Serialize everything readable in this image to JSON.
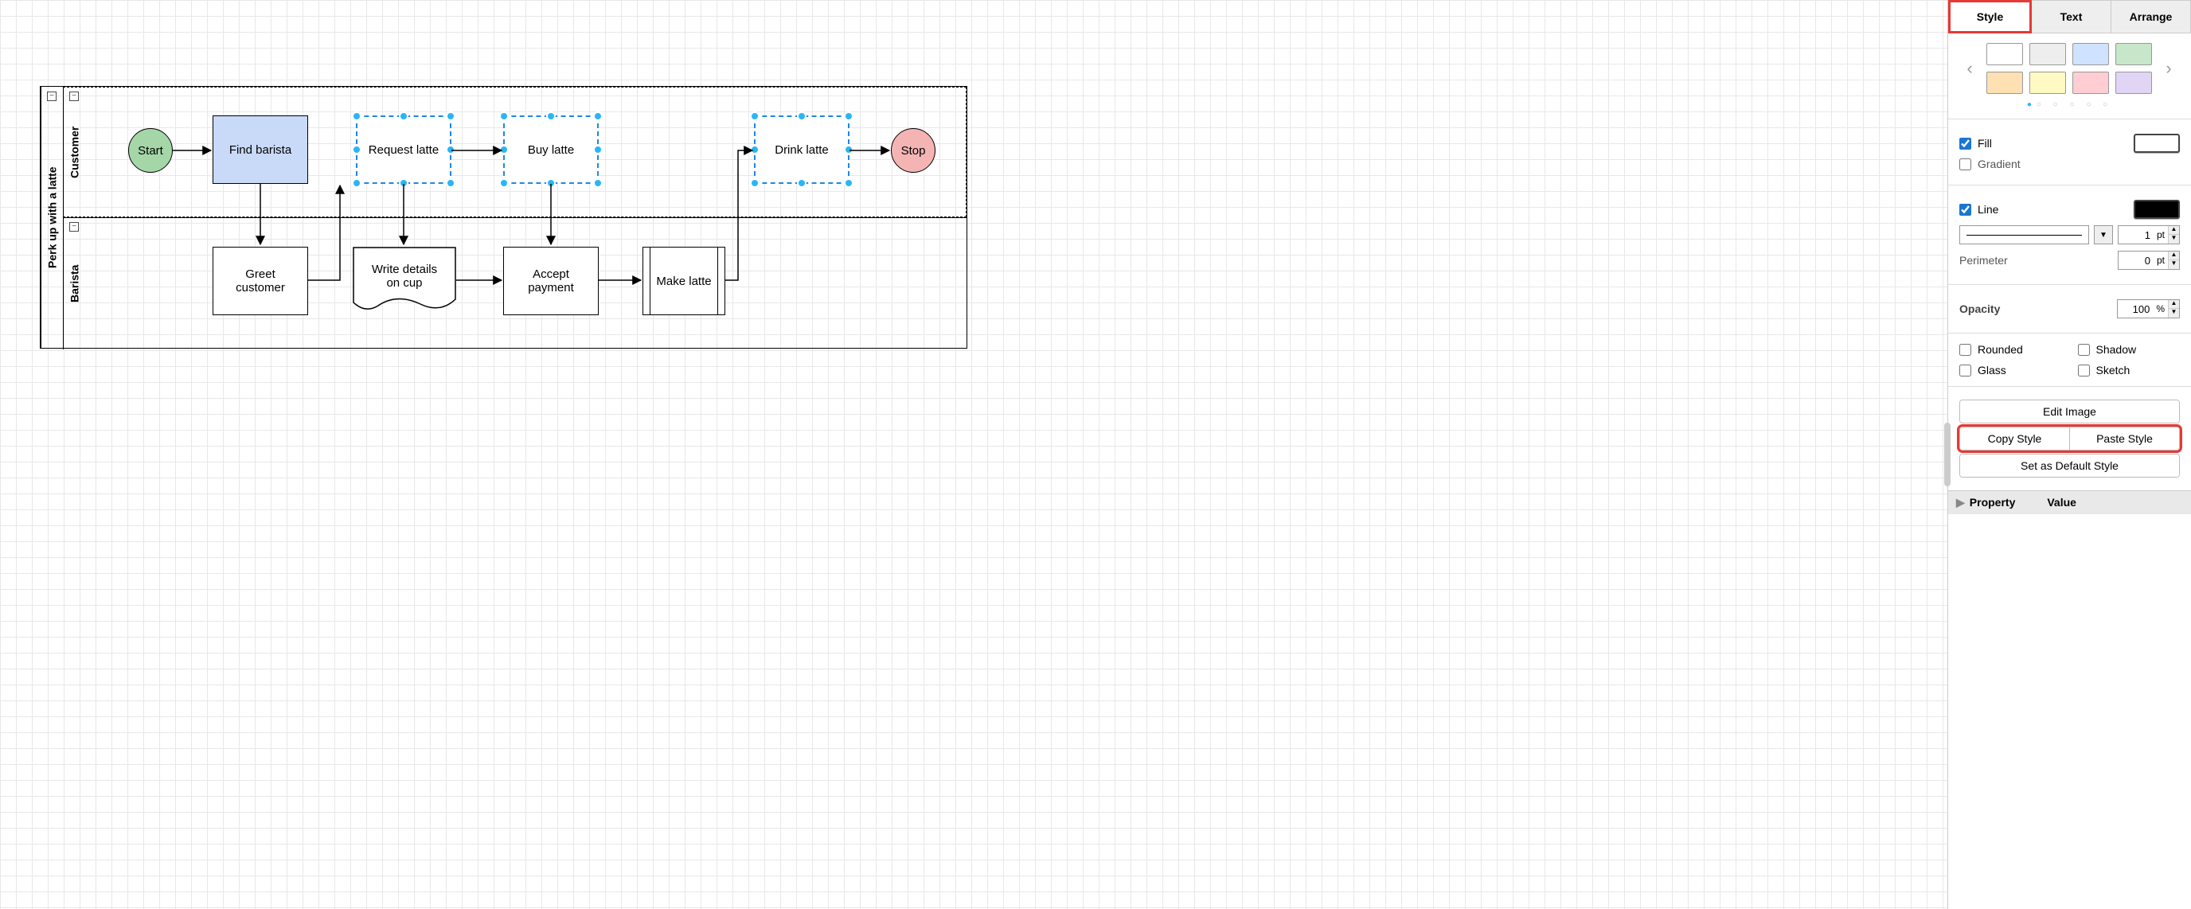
{
  "diagram": {
    "pool_title": "Perk up with a latte",
    "lanes": {
      "top": "Customer",
      "bottom": "Barista"
    },
    "nodes": {
      "start": "Start",
      "find_barista": "Find barista",
      "request_latte": "Request latte",
      "buy_latte": "Buy latte",
      "drink_latte": "Drink latte",
      "stop": "Stop",
      "greet_customer": "Greet\ncustomer",
      "write_details": "Write details\non cup",
      "accept_payment": "Accept\npayment",
      "make_latte": "Make latte"
    }
  },
  "panel": {
    "tabs": {
      "style": "Style",
      "text": "Text",
      "arrange": "Arrange"
    },
    "fill_label": "Fill",
    "gradient_label": "Gradient",
    "line_label": "Line",
    "line_width": "1",
    "line_width_unit": "pt",
    "perimeter_label": "Perimeter",
    "perimeter_value": "0",
    "perimeter_unit": "pt",
    "opacity_label": "Opacity",
    "opacity_value": "100",
    "opacity_unit": "%",
    "rounded": "Rounded",
    "shadow": "Shadow",
    "glass": "Glass",
    "sketch": "Sketch",
    "edit_image": "Edit Image",
    "copy_style": "Copy Style",
    "paste_style": "Paste Style",
    "set_default": "Set as Default Style",
    "property": "Property",
    "value": "Value"
  }
}
